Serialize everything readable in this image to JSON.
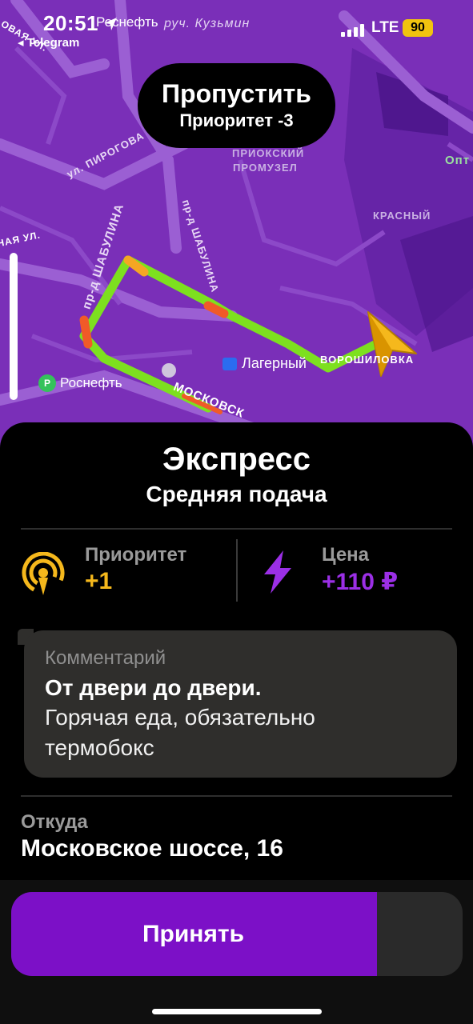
{
  "status_bar": {
    "time": "20:51",
    "back_app": "◂ Telegram",
    "network": "LTE",
    "battery": "90"
  },
  "map": {
    "skip_button": {
      "title": "Пропустить",
      "subtitle": "Приоритет -3"
    },
    "labels": {
      "street_kuzmin": "руч. Кузьмин",
      "street_pirogova": "ул. ПИРОГОВА",
      "street_shabulina_1": "пр-д ШАБУЛИНА",
      "street_shabulina_2": "пр-д ШАБУЛИНА",
      "zone_priokskiy_1": "ПРИОКСКИЙ",
      "zone_priokskiy_2": "ПРОМУЗЕЛ",
      "zone_krasny": "КРАСНЫЙ",
      "street_moskovskoe": "МОСКОВСК",
      "street_voroshilovka": "ВОРОШИЛОВКА",
      "street_naya": "НАЯ УЛ.",
      "street_ovaya": "ОВАЯ УЛ.",
      "opt": "Опт",
      "station": "Лагерный",
      "rosneft_top": "Роснефть",
      "rosneft_bottom": "Роснефть"
    },
    "colors": {
      "background": "#7a2fb8",
      "route": "#7de01f",
      "marker": "#f5b81c"
    }
  },
  "order": {
    "title": "Экспресс",
    "subtitle": "Средняя подача",
    "priority": {
      "label": "Приоритет",
      "value": "+1",
      "color": "#f5b81c"
    },
    "price": {
      "label": "Цена",
      "value": "+110 ₽",
      "color": "#9b2fe6"
    },
    "comment": {
      "label": "Комментарий",
      "bold": "От двери до двери.",
      "text_line1": "Горячая еда, обязательно",
      "text_line2": "термобокс"
    },
    "from": {
      "label": "Откуда",
      "value": "Московское шоссе, 16"
    }
  },
  "accept_button": {
    "label": "Принять",
    "progress": 0.81,
    "color": "#7c10c7"
  }
}
